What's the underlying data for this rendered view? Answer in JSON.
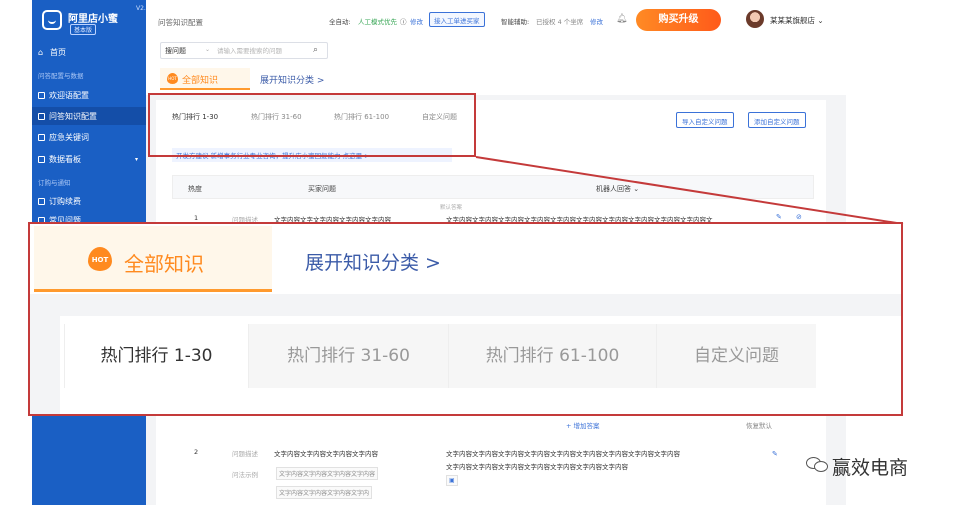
{
  "sidebar": {
    "app_name": "阿里店小蜜",
    "edition": "基本版",
    "version": "V2.0",
    "home": "首页",
    "section_qa": "问答配置与数据",
    "items": [
      "欢迎语配置",
      "问答知识配置",
      "应急关键词",
      "数据看板"
    ],
    "section_order": "订购与通知",
    "order_item": "订购续费",
    "cut_item": "常见问题"
  },
  "header": {
    "page_title": "问答知识配置",
    "auto_label": "全自动:",
    "auto_mode": "人工模式优先",
    "auto_edit": "修改",
    "transfer_btn": "接入工单进买家",
    "assist_label": "智能辅助:",
    "assist_status": "已授权 4 个坐席",
    "assist_edit": "修改",
    "upgrade": "购买升级",
    "store": "某某某旗舰店 ⌄"
  },
  "search": {
    "select": "搜问题",
    "caret": "⌄",
    "placeholder": "请输入需要搜索的问题",
    "icon": "search-icon"
  },
  "knowledge_tabs": {
    "hot_badge": "HOT",
    "all": "全部知识",
    "expand": "展开知识分类 >"
  },
  "sub_tabs": [
    "热门排行 1-30",
    "热门排行 31-60",
    "热门排行 61-100",
    "自定义问题"
  ],
  "actions": {
    "import_btn": "导入自定义问题",
    "add_btn": "添加自定义问题"
  },
  "suggestion": "开发方建议    新增事务行业专业咨询，提升店小蜜回复能力 点这里 >",
  "table": {
    "headers": [
      "热度",
      "买家问题",
      "机器人回答 ⌄"
    ],
    "row1": {
      "rank": "1",
      "label": "问题描述",
      "question": "文字内容文字文字内容文字内容文字内容",
      "answer_label": "默认答案",
      "answer": "文字内容文字内容文字内容文字内容文字内容文字内容文字内容文字内容文字内容文字内容文"
    },
    "add_answer": "+ 增加答案",
    "restore": "恢复默认",
    "row2": {
      "rank": "2",
      "label": "问题描述",
      "question": "文字内容文字内容文字内容文字内容",
      "example_label": "问法示例",
      "example1": "文字内容文字内容文字内容文字内容",
      "example2": "文字内容文字内容文字内容文字内",
      "answer1": "文字内容文字内容文字内容文字内容文字内容文字内容文字内容文字内容文字内容",
      "answer2": "文字内容文字内容文字内容文字内容文字内容文字内容文字内容"
    }
  },
  "zoom": {
    "hot_badge": "HOT",
    "all": "全部知识",
    "expand": "展开知识分类 >",
    "tabs": [
      "热门排行 1-30",
      "热门排行 31-60",
      "热门排行 61-100",
      "自定义问题"
    ]
  },
  "watermark": "赢效电商"
}
